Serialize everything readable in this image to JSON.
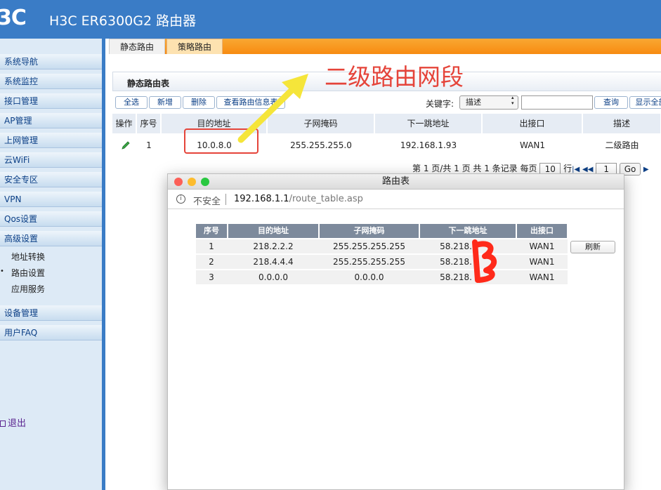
{
  "header": {
    "logo": "3C",
    "product": "H3C ER6300G2 路由器"
  },
  "sidebar": {
    "menus": [
      "系统导航",
      "系统监控",
      "接口管理",
      "AP管理",
      "上网管理",
      "云WiFi",
      "安全专区",
      "VPN",
      "Qos设置",
      "高级设置"
    ],
    "submenus": [
      "地址转换",
      "路由设置",
      "应用服务"
    ],
    "bottom_menus": [
      "设备管理",
      "用户FAQ"
    ],
    "exit": "退出"
  },
  "tabs": [
    "静态路由",
    "策略路由"
  ],
  "table_title": "静态路由表",
  "toolbar": {
    "select_all": "全选",
    "add": "新增",
    "delete": "删除",
    "view_info": "查看路由信息表",
    "keyword_label": "关键字:",
    "keyword_select": "描述",
    "query": "查询",
    "show_all": "显示全部"
  },
  "grid": {
    "headers": [
      "操作",
      "序号",
      "目的地址",
      "子网掩码",
      "下一跳地址",
      "出接口",
      "描述"
    ],
    "row": {
      "index": "1",
      "dest": "10.0.8.0",
      "mask": "255.255.255.0",
      "next_hop": "192.168.1.93",
      "iface": "WAN1",
      "desc": "二级路由"
    }
  },
  "pager": {
    "text": "第 1 页/共 1 页 共 1 条记录 每页",
    "per_page": "10",
    "rows_label": "行",
    "page_input": "1",
    "go": "Go"
  },
  "annotation": "二级路由网段",
  "popup": {
    "title": "路由表",
    "insecure": "不安全",
    "url_host": "192.168.1.1",
    "url_path": "/route_table.asp",
    "headers": [
      "序号",
      "目的地址",
      "子网掩码",
      "下一跳地址",
      "出接口"
    ],
    "rows": [
      [
        "1",
        "218.2.2.2",
        "255.255.255.255",
        "58.218.",
        "WAN1"
      ],
      [
        "2",
        "218.4.4.4",
        "255.255.255.255",
        "58.218.",
        "WAN1"
      ],
      [
        "3",
        "0.0.0.0",
        "0.0.0.0",
        "58.218.",
        "WAN1"
      ]
    ],
    "refresh": "刷新"
  },
  "colors": {
    "header_blue": "#3a7cc6",
    "tab_orange": "#f78b11",
    "annotation_red": "#e5443a",
    "arrow_yellow": "#f5e53a"
  }
}
